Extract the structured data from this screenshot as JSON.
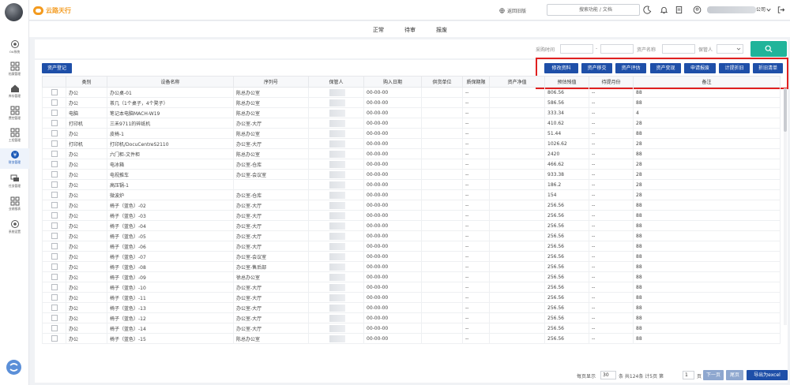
{
  "brand": {
    "name": "云路天行",
    "mark": "元分"
  },
  "header": {
    "back_old": "返回旧版",
    "search_placeholder": "搜索功能 / 文档",
    "user_company_suffix": "公司"
  },
  "sidebar": {
    "items": [
      {
        "label": "OA系统",
        "icon": "gear-circle-icon"
      },
      {
        "label": "档案管理",
        "icon": "grid-icon"
      },
      {
        "label": "库存管理",
        "icon": "house-icon"
      },
      {
        "label": "费控管理",
        "icon": "grid-icon"
      },
      {
        "label": "工程管理",
        "icon": "grid-icon"
      },
      {
        "label": "财务管理",
        "icon": "coin-icon"
      },
      {
        "label": "任务管理",
        "icon": "stack-icon"
      },
      {
        "label": "业绩报表",
        "icon": "grid-icon"
      },
      {
        "label": "系统设置",
        "icon": "gear-icon"
      }
    ]
  },
  "tabs": [
    "正常",
    "待审",
    "报废"
  ],
  "filter": {
    "purchase_time_label": "采购时间",
    "range_sep": "-",
    "asset_name_label": "资产名称",
    "keeper_label": "保管人"
  },
  "toolbar": {
    "register": "资产登记",
    "actions": [
      "修改资料",
      "资产移交",
      "资产评估",
      "资产变现",
      "申请报废",
      "计提折旧",
      "折旧清单"
    ]
  },
  "table": {
    "columns": [
      "类别",
      "设备名称",
      "序列号",
      "保管人",
      "购入日期",
      "供货单位",
      "质保期限",
      "资产净值",
      "预估残值",
      "待提月份",
      "备注"
    ],
    "rows": [
      [
        "办公",
        "办公桌-01",
        "陈总办公室",
        "00-00-00",
        "--",
        "806.56",
        "--",
        "88",
        "董事长用"
      ],
      [
        "办公",
        "茶几（1个桌子，4个凳子）",
        "陈总办公室",
        "00-00-00",
        "--",
        "586.56",
        "--",
        "88",
        "董事长用"
      ],
      [
        "电脑",
        "笔记本电脑MACH-W19",
        "陈总办公室",
        "00-00-00",
        "--",
        "333.34",
        "--",
        "4",
        "董事长用"
      ],
      [
        "打印机",
        "三禾9711的碎纸机",
        "办公室-大厅",
        "00-00-00",
        "--",
        "410.62",
        "--",
        "28",
        "办公室公用"
      ],
      [
        "办公",
        "皮椅-1",
        "陈总办公室",
        "00-00-00",
        "--",
        "51.44",
        "--",
        "88",
        "董事长用"
      ],
      [
        "打印机",
        "打印机/DocuCentreS2110",
        "办公室-大厅",
        "00-00-00",
        "--",
        "1026.62",
        "--",
        "28",
        "办公室公用"
      ],
      [
        "办公",
        "六门柜-文件柜",
        "陈总办公室",
        "00-00-00",
        "--",
        "2420",
        "--",
        "88",
        "董事长用"
      ],
      [
        "办公",
        "电冰箱",
        "办公室-仓库",
        "00-00-00",
        "--",
        "466.62",
        "--",
        "28",
        "办公室公用"
      ],
      [
        "办公",
        "电视推车",
        "办公室-会议室",
        "00-00-00",
        "--",
        "933.38",
        "--",
        "28",
        "会议室用"
      ],
      [
        "办公",
        "高压锅-1",
        "",
        "00-00-00",
        "--",
        "186.2",
        "--",
        "28",
        "销售部用 已坏"
      ],
      [
        "办公",
        "微波炉",
        "办公室-仓库",
        "00-00-00",
        "--",
        "154",
        "--",
        "28",
        "办公室公用"
      ],
      [
        "办公",
        "椅子（蓝色）-02",
        "办公室-大厅",
        "00-00-00",
        "--",
        "256.56",
        "--",
        "88",
        "项目部用"
      ],
      [
        "办公",
        "椅子（蓝色）-03",
        "办公室-大厅",
        "00-00-00",
        "--",
        "256.56",
        "--",
        "88",
        "项目部用"
      ],
      [
        "办公",
        "椅子（蓝色）-04",
        "办公室-大厅",
        "00-00-00",
        "--",
        "256.56",
        "--",
        "88",
        "项目部用"
      ],
      [
        "办公",
        "椅子（蓝色）-05",
        "办公室-大厅",
        "00-00-00",
        "--",
        "256.56",
        "--",
        "88",
        "售前用"
      ],
      [
        "办公",
        "椅子（蓝色）-06",
        "办公室-大厅",
        "00-00-00",
        "--",
        "256.56",
        "--",
        "88",
        "项目部用"
      ],
      [
        "办公",
        "椅子（蓝色）-07",
        "办公室-会议室",
        "00-00-00",
        "--",
        "256.56",
        "--",
        "88",
        "会议室用"
      ],
      [
        "办公",
        "椅子（蓝色）-08",
        "办公室-售后部",
        "00-00-00",
        "--",
        "256.56",
        "--",
        "88",
        "售后部用"
      ],
      [
        "办公",
        "椅子（蓝色）-09",
        "徐总办公室",
        "00-00-00",
        "--",
        "256.56",
        "--",
        "88",
        "总经理用"
      ],
      [
        "办公",
        "椅子（蓝色）-10",
        "办公室-大厅",
        "00-00-00",
        "--",
        "256.56",
        "--",
        "88",
        "销售部用"
      ],
      [
        "办公",
        "椅子（蓝色）-11",
        "办公室-大厅",
        "00-00-00",
        "--",
        "256.56",
        "--",
        "88",
        "销售部用"
      ],
      [
        "办公",
        "椅子（蓝色）-13",
        "办公室-大厅",
        "00-00-00",
        "--",
        "256.56",
        "--",
        "88",
        "销售部用"
      ],
      [
        "办公",
        "椅子（蓝色）-12",
        "办公室-大厅",
        "00-00-00",
        "--",
        "256.56",
        "--",
        "88",
        "销售部用"
      ],
      [
        "办公",
        "椅子（蓝色）-14",
        "办公室-大厅",
        "00-00-00",
        "--",
        "256.56",
        "--",
        "88",
        "销售部用"
      ],
      [
        "办公",
        "椅子（蓝色）-15",
        "陈总办公室",
        "00-00-00",
        "--",
        "256.56",
        "--",
        "88",
        "董事长用"
      ]
    ]
  },
  "pager": {
    "per_page_label": "每页显示",
    "per_page": "30",
    "summary": "条 共124条 计5页 第",
    "page": "1",
    "page_suffix": "页",
    "next": "下一页",
    "last": "尾页",
    "export": "导出为excel"
  },
  "colors": {
    "primary": "#1e4fa8",
    "accent": "#20b49a",
    "highlight": "#e02020",
    "brand": "#f39a1e"
  }
}
